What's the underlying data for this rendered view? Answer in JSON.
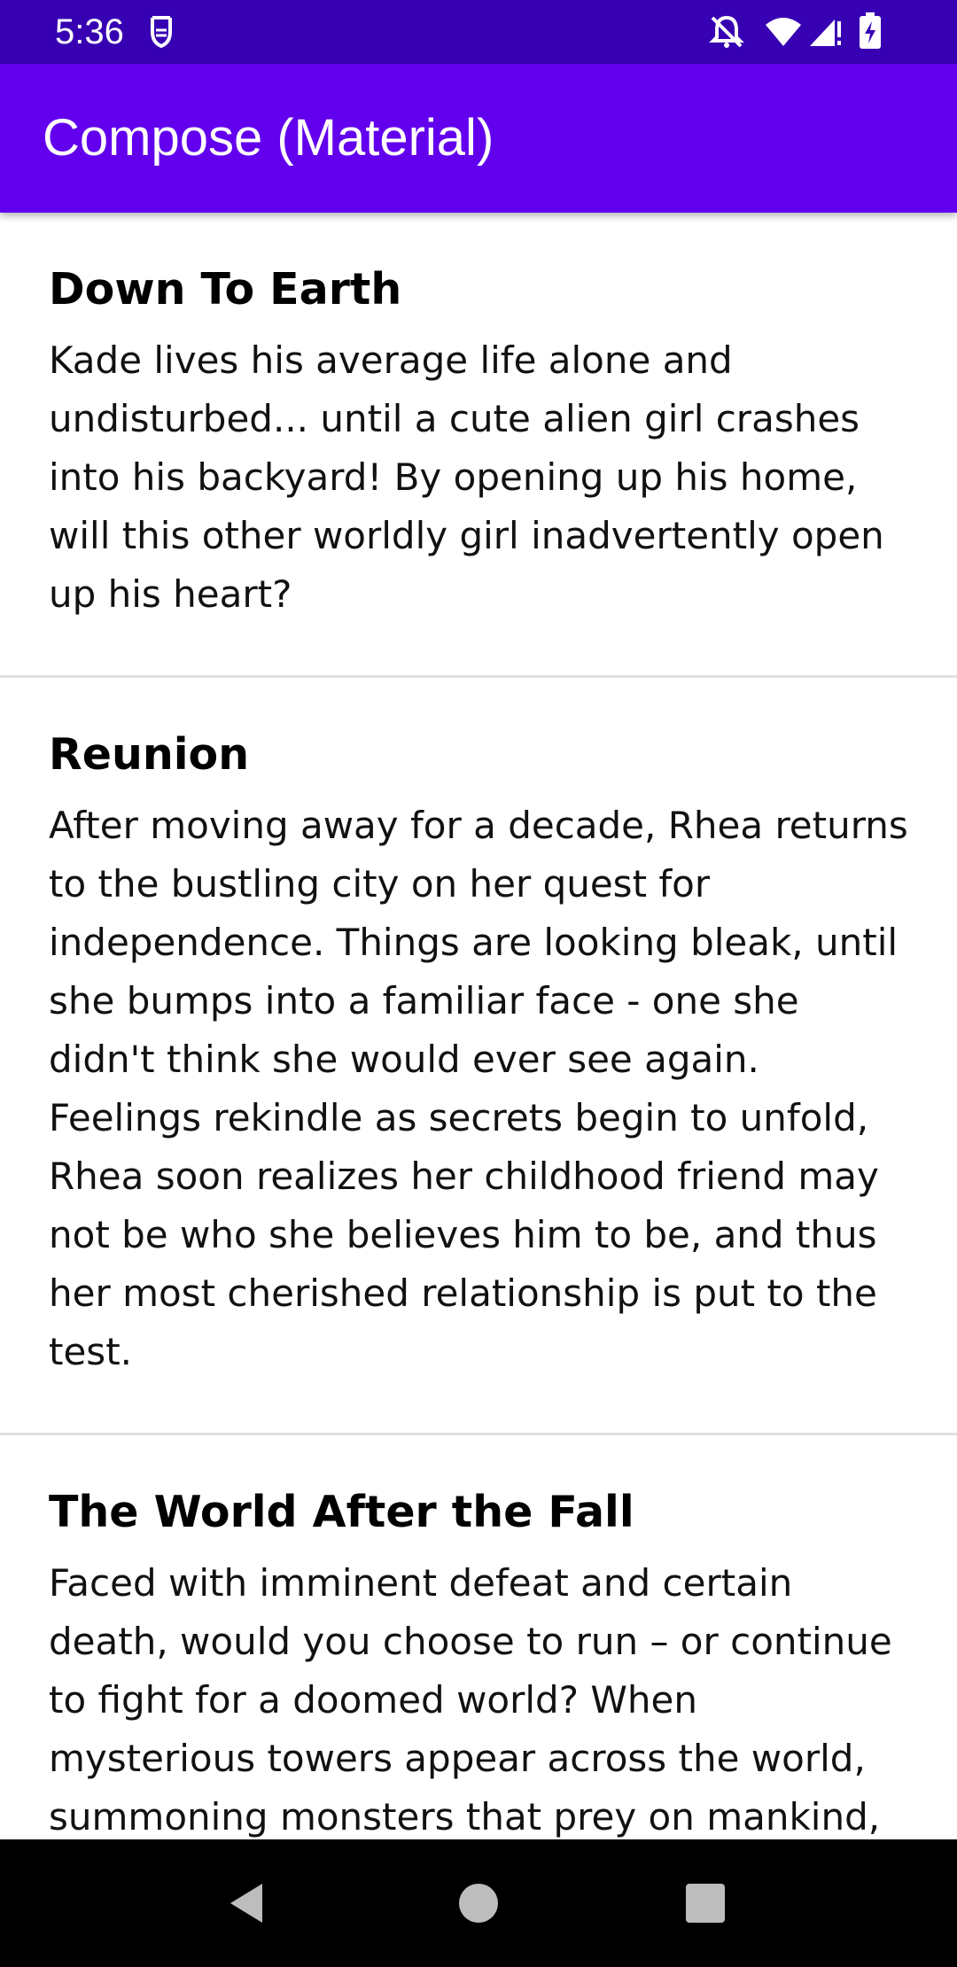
{
  "status_bar": {
    "time": "5:36",
    "icons": [
      "notification-shield-icon",
      "bell-off-icon",
      "wifi-icon",
      "signal-icon",
      "battery-charging-icon"
    ]
  },
  "app_bar": {
    "title": "Compose (Material)"
  },
  "items": [
    {
      "title": "Down To Earth",
      "description": "Kade lives his average life alone and undisturbed... until a cute alien girl crashes into his backyard! By opening up his home, will this other worldly girl inadvertently open up his heart?"
    },
    {
      "title": "Reunion",
      "description": "After moving away for a decade, Rhea returns to the bustling city on her quest for independence. Things are looking bleak, until she bumps into a familiar face - one she didn't think she would ever see again. Feelings rekindle as secrets begin to unfold, Rhea soon realizes her childhood friend may not be who she believes him to be, and thus her most cherished relationship is put to the test."
    },
    {
      "title": "The World After the Fall",
      "description": "Faced with imminent defeat and certain death, would you choose to run – or continue to fight for a doomed world? When mysterious towers appear across the world, summoning monsters that prey on mankind,"
    }
  ],
  "nav_bar": {
    "icons": [
      "back-icon",
      "home-icon",
      "recents-icon"
    ]
  },
  "colors": {
    "status_bar": "#3700b3",
    "primary": "#6200ee",
    "divider": "#e0e0e0"
  }
}
